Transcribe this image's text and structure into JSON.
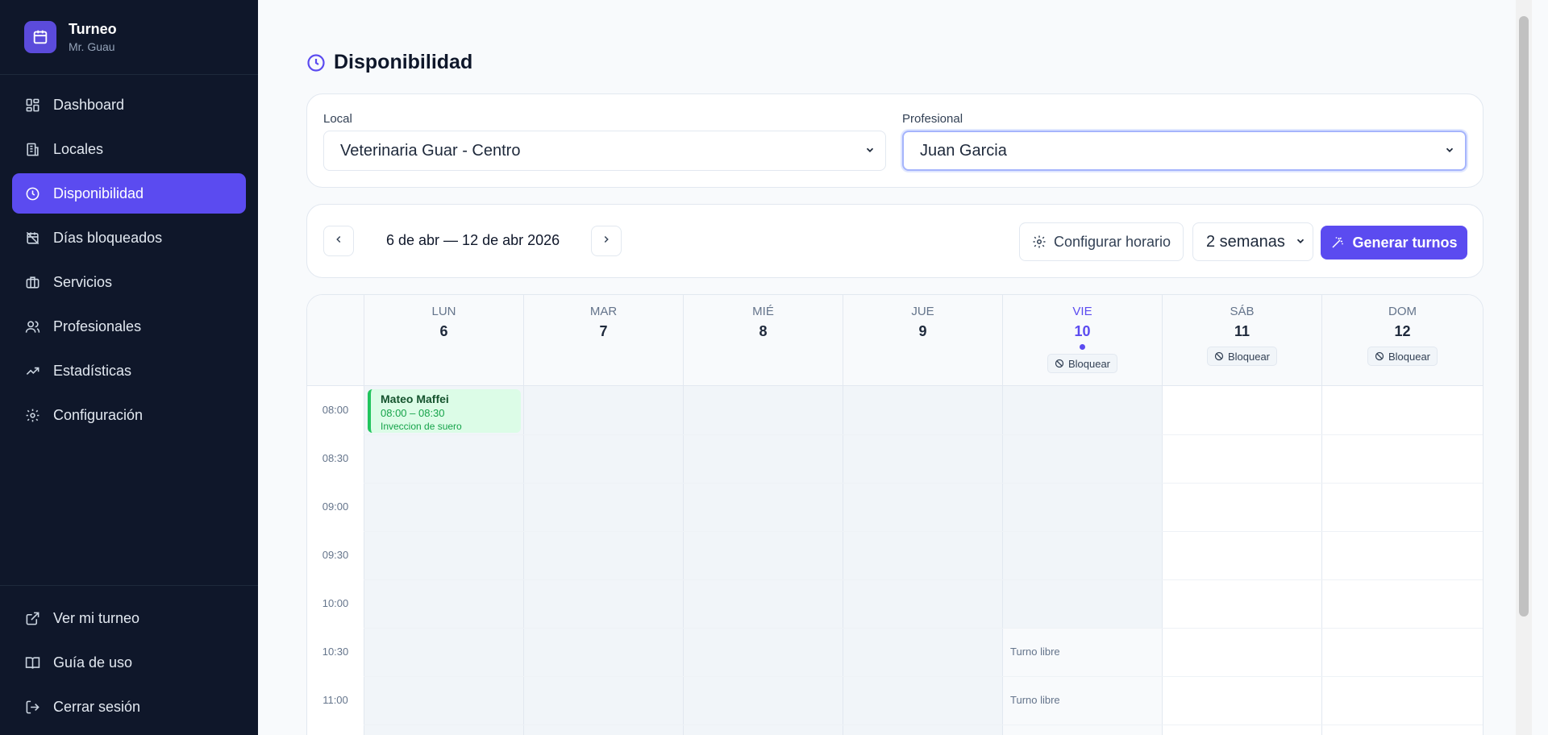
{
  "brand": {
    "title": "Turneo",
    "subtitle": "Mr. Guau"
  },
  "sidebar": {
    "items": [
      {
        "label": "Dashboard",
        "icon": "dashboard-icon"
      },
      {
        "label": "Locales",
        "icon": "building-icon"
      },
      {
        "label": "Disponibilidad",
        "icon": "clock-icon",
        "active": true
      },
      {
        "label": "Días bloqueados",
        "icon": "calendar-off-icon"
      },
      {
        "label": "Servicios",
        "icon": "briefcase-icon"
      },
      {
        "label": "Profesionales",
        "icon": "users-icon"
      },
      {
        "label": "Estadísticas",
        "icon": "trending-up-icon"
      },
      {
        "label": "Configuración",
        "icon": "gear-icon"
      }
    ],
    "bottom_items": [
      {
        "label": "Ver mi turneo",
        "icon": "external-link-icon"
      },
      {
        "label": "Guía de uso",
        "icon": "book-icon"
      },
      {
        "label": "Cerrar sesión",
        "icon": "logout-icon"
      }
    ]
  },
  "page": {
    "title": "Disponibilidad"
  },
  "filters": {
    "local_label": "Local",
    "local_value": "Veterinaria Guar - Centro",
    "profesional_label": "Profesional",
    "profesional_value": "Juan Garcia"
  },
  "toolbar": {
    "range": "6 de abr — 12 de abr 2026",
    "configure_label": "Configurar horario",
    "weeks_value": "2 semanas",
    "generate_label": "Generar turnos"
  },
  "calendar": {
    "days": [
      {
        "name": "LUN",
        "num": "6"
      },
      {
        "name": "MAR",
        "num": "7"
      },
      {
        "name": "MIÉ",
        "num": "8"
      },
      {
        "name": "JUE",
        "num": "9"
      },
      {
        "name": "VIE",
        "num": "10",
        "today": true,
        "block_label": "Bloquear"
      },
      {
        "name": "SÁB",
        "num": "11",
        "block_label": "Bloquear"
      },
      {
        "name": "DOM",
        "num": "12",
        "block_label": "Bloquear"
      }
    ],
    "times": [
      "08:00",
      "08:30",
      "09:00",
      "09:30",
      "10:00",
      "10:30",
      "11:00"
    ],
    "appointment": {
      "name": "Mateo Maffei",
      "time": "08:00 – 08:30",
      "service": "Inveccion de suero"
    },
    "free_label": "Turno libre"
  },
  "colors": {
    "accent": "#5b4bf0",
    "sidebar_bg": "#0f172a",
    "appointment_bg": "#dcfce7",
    "appointment_border": "#22c55e"
  }
}
